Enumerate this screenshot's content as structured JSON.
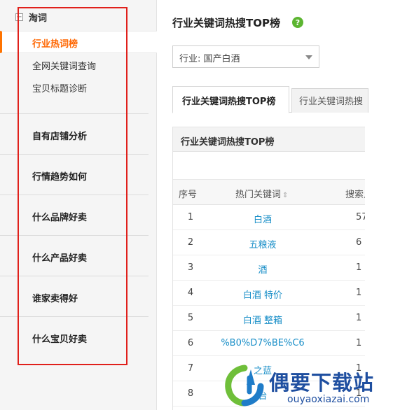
{
  "sidebar": {
    "group_title": "淘词",
    "group_toggle": "−",
    "active_item": "行业热词榜",
    "sub_items": [
      "全网关键词查询",
      "宝贝标题诊断"
    ],
    "nav_items": [
      "自有店铺分析",
      "行情趋势如何",
      "什么品牌好卖",
      "什么产品好卖",
      "谁家卖得好",
      "什么宝贝好卖"
    ]
  },
  "main": {
    "title": "行业关键词热搜TOP榜",
    "help_icon": "?",
    "industry_select": "行业: 国产白酒",
    "tabs": [
      "行业关键词热搜TOP榜",
      "行业关键词热搜"
    ],
    "panel_title": "行业关键词热搜TOP榜",
    "columns": [
      "序号",
      "热门关键词",
      "搜索人"
    ],
    "rows": [
      {
        "idx": "1",
        "keyword": "白酒",
        "value": "57"
      },
      {
        "idx": "2",
        "keyword": "五粮液",
        "value": "6"
      },
      {
        "idx": "3",
        "keyword": "酒",
        "value": "1"
      },
      {
        "idx": "4",
        "keyword": "白酒 特价",
        "value": "1"
      },
      {
        "idx": "5",
        "keyword": "白酒 整箱",
        "value": "1"
      },
      {
        "idx": "6",
        "keyword": "%B0%D7%BE%C6",
        "value": "1"
      },
      {
        "idx": "7",
        "keyword": "之蓝",
        "value": "1"
      },
      {
        "idx": "8",
        "keyword": "台",
        "value": "1"
      }
    ]
  },
  "watermark": {
    "title": "偶要下载站",
    "url": "ouyaoxiazai.com"
  },
  "colors": {
    "accent": "#ff6600",
    "link": "#1a8fc8",
    "highlight_box": "#e0201b",
    "help": "#5cb531"
  }
}
